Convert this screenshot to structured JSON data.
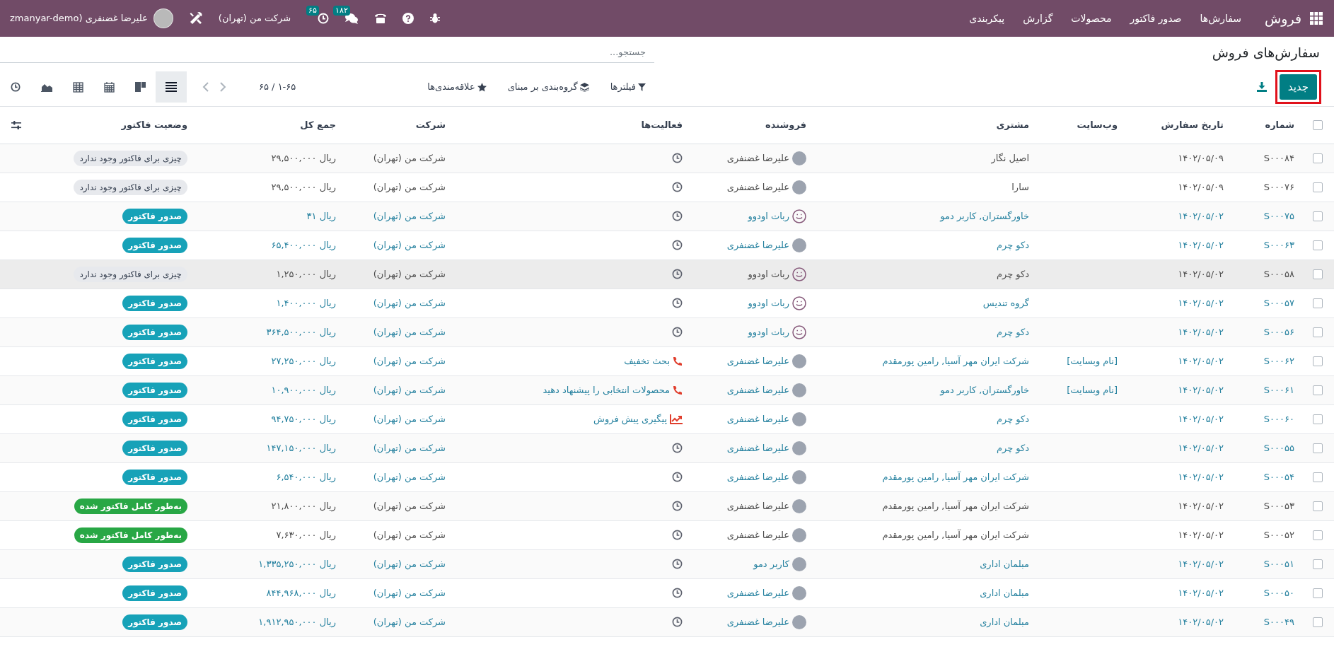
{
  "navbar": {
    "app": "فروش",
    "menu": [
      {
        "label": "سفارش‌ها"
      },
      {
        "label": "صدور فاکتور"
      },
      {
        "label": "محصولات"
      },
      {
        "label": "گزارش"
      },
      {
        "label": "پیکربندی"
      }
    ],
    "systray": [
      {
        "kind": "bug"
      },
      {
        "kind": "help"
      },
      {
        "kind": "phone"
      },
      {
        "kind": "chat",
        "badge": "۱۸۲"
      },
      {
        "kind": "activity",
        "badge": "۶۵"
      }
    ],
    "company": "شرکت من (تهران)",
    "user": "علیرضا غضنفری (zmanyar-demo"
  },
  "control_panel": {
    "title": "سفارش‌های فروش",
    "search": {
      "placeholder": "جستجو..."
    },
    "new_button": "جدید",
    "new_button_highlighted": true,
    "filters": [
      {
        "kind": "filter",
        "label": "فیلترها"
      },
      {
        "kind": "group",
        "label": "گروه‌بندی بر مبنای"
      },
      {
        "kind": "favorite",
        "label": "علاقه‌مندی‌ها"
      }
    ],
    "pager": "۱-۶۵ / ۶۵",
    "views": [
      {
        "kind": "list",
        "selected": true
      },
      {
        "kind": "kanban",
        "selected": false
      },
      {
        "kind": "calendar",
        "selected": false
      },
      {
        "kind": "pivot",
        "selected": false
      },
      {
        "kind": "graph",
        "selected": false
      },
      {
        "kind": "activity",
        "selected": false
      }
    ]
  },
  "table": {
    "select_all_checked": false,
    "columns": [
      "شماره",
      "تاریخ سفارش",
      "وب‌سایت",
      "مشتری",
      "فروشنده",
      "فعالیت‌ها",
      "شرکت",
      "جمع کل",
      "وضعیت فاکتور"
    ],
    "rows": [
      {
        "number": "S۰۰۰۸۴",
        "date": "۱۴۰۲/۰۵/۰۹",
        "customer": "اصیل نگار",
        "salesperson": {
          "name": "علیرضا غضنفری",
          "kind": "photo"
        },
        "activity": {
          "kind": "clock"
        },
        "company": "شرکت من (تهران)",
        "total": "ریال ۲۹,۵۰۰,۰۰۰",
        "invoice_status": {
          "kind": "nothing",
          "label": "چیزی برای فاکتور وجود ندارد"
        },
        "muted": true,
        "hovered": false,
        "checked": false
      },
      {
        "number": "S۰۰۰۷۶",
        "date": "۱۴۰۲/۰۵/۰۹",
        "customer": "سارا",
        "salesperson": {
          "name": "علیرضا غضنفری",
          "kind": "photo"
        },
        "activity": {
          "kind": "clock"
        },
        "company": "شرکت من (تهران)",
        "total": "ریال ۲۹,۵۰۰,۰۰۰",
        "invoice_status": {
          "kind": "nothing",
          "label": "چیزی برای فاکتور وجود ندارد"
        },
        "muted": true,
        "hovered": false,
        "checked": false
      },
      {
        "number": "S۰۰۰۷۵",
        "date": "۱۴۰۲/۰۵/۰۲",
        "customer": "خاورگستران, کاربر دمو",
        "salesperson": {
          "name": "ربات اودوو",
          "kind": "robot"
        },
        "activity": {
          "kind": "clock"
        },
        "company": "شرکت من (تهران)",
        "total": "ریال ۳۱",
        "invoice_status": {
          "kind": "to_invoice",
          "label": "صدور فاکتور"
        },
        "muted": false,
        "hovered": false,
        "checked": false
      },
      {
        "number": "S۰۰۰۶۳",
        "date": "۱۴۰۲/۰۵/۰۲",
        "customer": "دکو چرم",
        "salesperson": {
          "name": "علیرضا غضنفری",
          "kind": "photo"
        },
        "activity": {
          "kind": "clock"
        },
        "company": "شرکت من (تهران)",
        "total": "ریال ۶۵,۴۰۰,۰۰۰",
        "invoice_status": {
          "kind": "to_invoice",
          "label": "صدور فاکتور"
        },
        "muted": false,
        "hovered": false,
        "checked": false
      },
      {
        "number": "S۰۰۰۵۸",
        "date": "۱۴۰۲/۰۵/۰۲",
        "customer": "دکو چرم",
        "salesperson": {
          "name": "ربات اودوو",
          "kind": "robot"
        },
        "activity": {
          "kind": "clock"
        },
        "company": "شرکت من (تهران)",
        "total": "ریال ۱,۲۵۰,۰۰۰",
        "invoice_status": {
          "kind": "nothing",
          "label": "چیزی برای فاکتور وجود ندارد"
        },
        "muted": true,
        "hovered": true,
        "checked": false
      },
      {
        "number": "S۰۰۰۵۷",
        "date": "۱۴۰۲/۰۵/۰۲",
        "customer": "گروه تندیس",
        "salesperson": {
          "name": "ربات اودوو",
          "kind": "robot"
        },
        "activity": {
          "kind": "clock"
        },
        "company": "شرکت من (تهران)",
        "total": "ریال ۱,۴۰۰,۰۰۰",
        "invoice_status": {
          "kind": "to_invoice",
          "label": "صدور فاکتور"
        },
        "muted": false,
        "hovered": false,
        "checked": false
      },
      {
        "number": "S۰۰۰۵۶",
        "date": "۱۴۰۲/۰۵/۰۲",
        "customer": "دکو چرم",
        "salesperson": {
          "name": "ربات اودوو",
          "kind": "robot"
        },
        "activity": {
          "kind": "clock"
        },
        "company": "شرکت من (تهران)",
        "total": "ریال ۳۶۴,۵۰۰,۰۰۰",
        "invoice_status": {
          "kind": "to_invoice",
          "label": "صدور فاکتور"
        },
        "muted": false,
        "hovered": false,
        "checked": false
      },
      {
        "number": "S۰۰۰۶۲",
        "date": "۱۴۰۲/۰۵/۰۲",
        "website": "[نام وبسایت]",
        "customer": "شرکت ایران مهر آسیا, رامین پورمقدم",
        "salesperson": {
          "name": "علیرضا غضنفری",
          "kind": "photo"
        },
        "activity": {
          "kind": "phone",
          "label": "بحث تخفیف"
        },
        "company": "شرکت من (تهران)",
        "total": "ریال ۲۷,۲۵۰,۰۰۰",
        "invoice_status": {
          "kind": "to_invoice",
          "label": "صدور فاکتور"
        },
        "muted": false,
        "hovered": false,
        "checked": false
      },
      {
        "number": "S۰۰۰۶۱",
        "date": "۱۴۰۲/۰۵/۰۲",
        "website": "[نام وبسایت]",
        "customer": "خاورگستران, کاربر دمو",
        "salesperson": {
          "name": "علیرضا غضنفری",
          "kind": "photo"
        },
        "activity": {
          "kind": "phone",
          "label": "محصولات انتخابی را پیشنهاد دهید"
        },
        "company": "شرکت من (تهران)",
        "total": "ریال ۱۰,۹۰۰,۰۰۰",
        "invoice_status": {
          "kind": "to_invoice",
          "label": "صدور فاکتور"
        },
        "muted": false,
        "hovered": false,
        "checked": false
      },
      {
        "number": "S۰۰۰۶۰",
        "date": "۱۴۰۲/۰۵/۰۲",
        "customer": "دکو چرم",
        "salesperson": {
          "name": "علیرضا غضنفری",
          "kind": "photo"
        },
        "activity": {
          "kind": "chart",
          "label": "پیگیری پیش فروش"
        },
        "company": "شرکت من (تهران)",
        "total": "ریال ۹۴,۷۵۰,۰۰۰",
        "invoice_status": {
          "kind": "to_invoice",
          "label": "صدور فاکتور"
        },
        "muted": false,
        "hovered": false,
        "checked": false
      },
      {
        "number": "S۰۰۰۵۵",
        "date": "۱۴۰۲/۰۵/۰۲",
        "customer": "دکو چرم",
        "salesperson": {
          "name": "علیرضا غضنفری",
          "kind": "photo"
        },
        "activity": {
          "kind": "clock"
        },
        "company": "شرکت من (تهران)",
        "total": "ریال ۱۴۷,۱۵۰,۰۰۰",
        "invoice_status": {
          "kind": "to_invoice",
          "label": "صدور فاکتور"
        },
        "muted": false,
        "hovered": false,
        "checked": false
      },
      {
        "number": "S۰۰۰۵۴",
        "date": "۱۴۰۲/۰۵/۰۲",
        "customer": "شرکت ایران مهر آسیا, رامین پورمقدم",
        "salesperson": {
          "name": "علیرضا غضنفری",
          "kind": "photo"
        },
        "activity": {
          "kind": "clock"
        },
        "company": "شرکت من (تهران)",
        "total": "ریال ۶,۵۴۰,۰۰۰",
        "invoice_status": {
          "kind": "to_invoice",
          "label": "صدور فاکتور"
        },
        "muted": false,
        "hovered": false,
        "checked": false
      },
      {
        "number": "S۰۰۰۵۳",
        "date": "۱۴۰۲/۰۵/۰۲",
        "customer": "شرکت ایران مهر آسیا, رامین پورمقدم",
        "salesperson": {
          "name": "علیرضا غضنفری",
          "kind": "photo"
        },
        "activity": {
          "kind": "clock"
        },
        "company": "شرکت من (تهران)",
        "total": "ریال ۲۱,۸۰۰,۰۰۰",
        "invoice_status": {
          "kind": "invoiced",
          "label": "به‌طور کامل فاکتور شده"
        },
        "muted": true,
        "hovered": false,
        "checked": false
      },
      {
        "number": "S۰۰۰۵۲",
        "date": "۱۴۰۲/۰۵/۰۲",
        "customer": "شرکت ایران مهر آسیا, رامین پورمقدم",
        "salesperson": {
          "name": "علیرضا غضنفری",
          "kind": "photo"
        },
        "activity": {
          "kind": "clock"
        },
        "company": "شرکت من (تهران)",
        "total": "ریال ۷,۶۳۰,۰۰۰",
        "invoice_status": {
          "kind": "invoiced",
          "label": "به‌طور کامل فاکتور شده"
        },
        "muted": true,
        "hovered": false,
        "checked": false
      },
      {
        "number": "S۰۰۰۵۱",
        "date": "۱۴۰۲/۰۵/۰۲",
        "customer": "مبلمان اداری",
        "salesperson": {
          "name": "کاربر دمو",
          "kind": "photo"
        },
        "activity": {
          "kind": "clock"
        },
        "company": "شرکت من (تهران)",
        "total": "ریال ۱,۳۳۵,۲۵۰,۰۰۰",
        "invoice_status": {
          "kind": "to_invoice",
          "label": "صدور فاکتور"
        },
        "muted": false,
        "hovered": false,
        "checked": false
      },
      {
        "number": "S۰۰۰۵۰",
        "date": "۱۴۰۲/۰۵/۰۲",
        "customer": "مبلمان اداری",
        "salesperson": {
          "name": "علیرضا غضنفری",
          "kind": "photo"
        },
        "activity": {
          "kind": "clock"
        },
        "company": "شرکت من (تهران)",
        "total": "ریال ۸۴۴,۹۶۸,۰۰۰",
        "invoice_status": {
          "kind": "to_invoice",
          "label": "صدور فاکتور"
        },
        "muted": false,
        "hovered": false,
        "checked": false
      },
      {
        "number": "S۰۰۰۴۹",
        "date": "۱۴۰۲/۰۵/۰۲",
        "customer": "مبلمان اداری",
        "salesperson": {
          "name": "علیرضا غضنفری",
          "kind": "photo"
        },
        "activity": {
          "kind": "clock"
        },
        "company": "شرکت من (تهران)",
        "total": "ریال ۱,۹۱۲,۹۵۰,۰۰۰",
        "invoice_status": {
          "kind": "to_invoice",
          "label": "صدور فاکتور"
        },
        "muted": false,
        "hovered": false,
        "checked": false
      }
    ]
  }
}
